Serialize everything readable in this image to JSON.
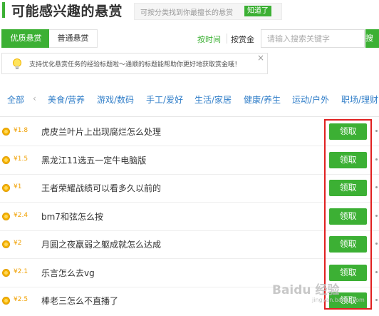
{
  "header": {
    "title": "可能感兴趣的悬赏",
    "tip": "可按分类找到你最擅长的悬赏",
    "ok_label": "知道了"
  },
  "tabs": [
    {
      "label": "优质悬赏"
    },
    {
      "label": "普通悬赏"
    }
  ],
  "sort": {
    "by_time": "按时间",
    "by_reward": "按赏金"
  },
  "search": {
    "placeholder": "请输入搜索关键字",
    "button": "搜"
  },
  "notice": {
    "text": "支持优化悬赏任务的经验标题啦～通顺的标题能帮助你更好地获取赏金哦！",
    "close": "×"
  },
  "categories": [
    "全部",
    "‹",
    "美食/营养",
    "游戏/数码",
    "手工/爱好",
    "生活/家居",
    "健康/养生",
    "运动/户外",
    "职场/理财"
  ],
  "rewards": [
    {
      "amount": "¥1.8",
      "title": "虎皮兰叶片上出现腐烂怎么处理",
      "action": "领取"
    },
    {
      "amount": "¥1.5",
      "title": "黑龙江11选五一定牛电脑版",
      "action": "领取"
    },
    {
      "amount": "¥1",
      "title": "王者荣耀战绩可以看多久以前的",
      "action": "领取"
    },
    {
      "amount": "¥2.4",
      "title": "bm7和弦怎么按",
      "action": "领取"
    },
    {
      "amount": "¥2",
      "title": "月圆之夜羸弱之躯成就怎么达成",
      "action": "领取"
    },
    {
      "amount": "¥2.1",
      "title": "乐言怎么去vg",
      "action": "领取"
    },
    {
      "amount": "¥2.5",
      "title": "棒老三怎么不直播了",
      "action": "领取"
    }
  ],
  "watermark": {
    "text": "Baidu 经验",
    "url": "jingyan.baidu.com"
  },
  "colors": {
    "accent": "#3cb034",
    "link": "#2f7dc8",
    "reward": "#f0a000",
    "highlight": "#e02020"
  }
}
